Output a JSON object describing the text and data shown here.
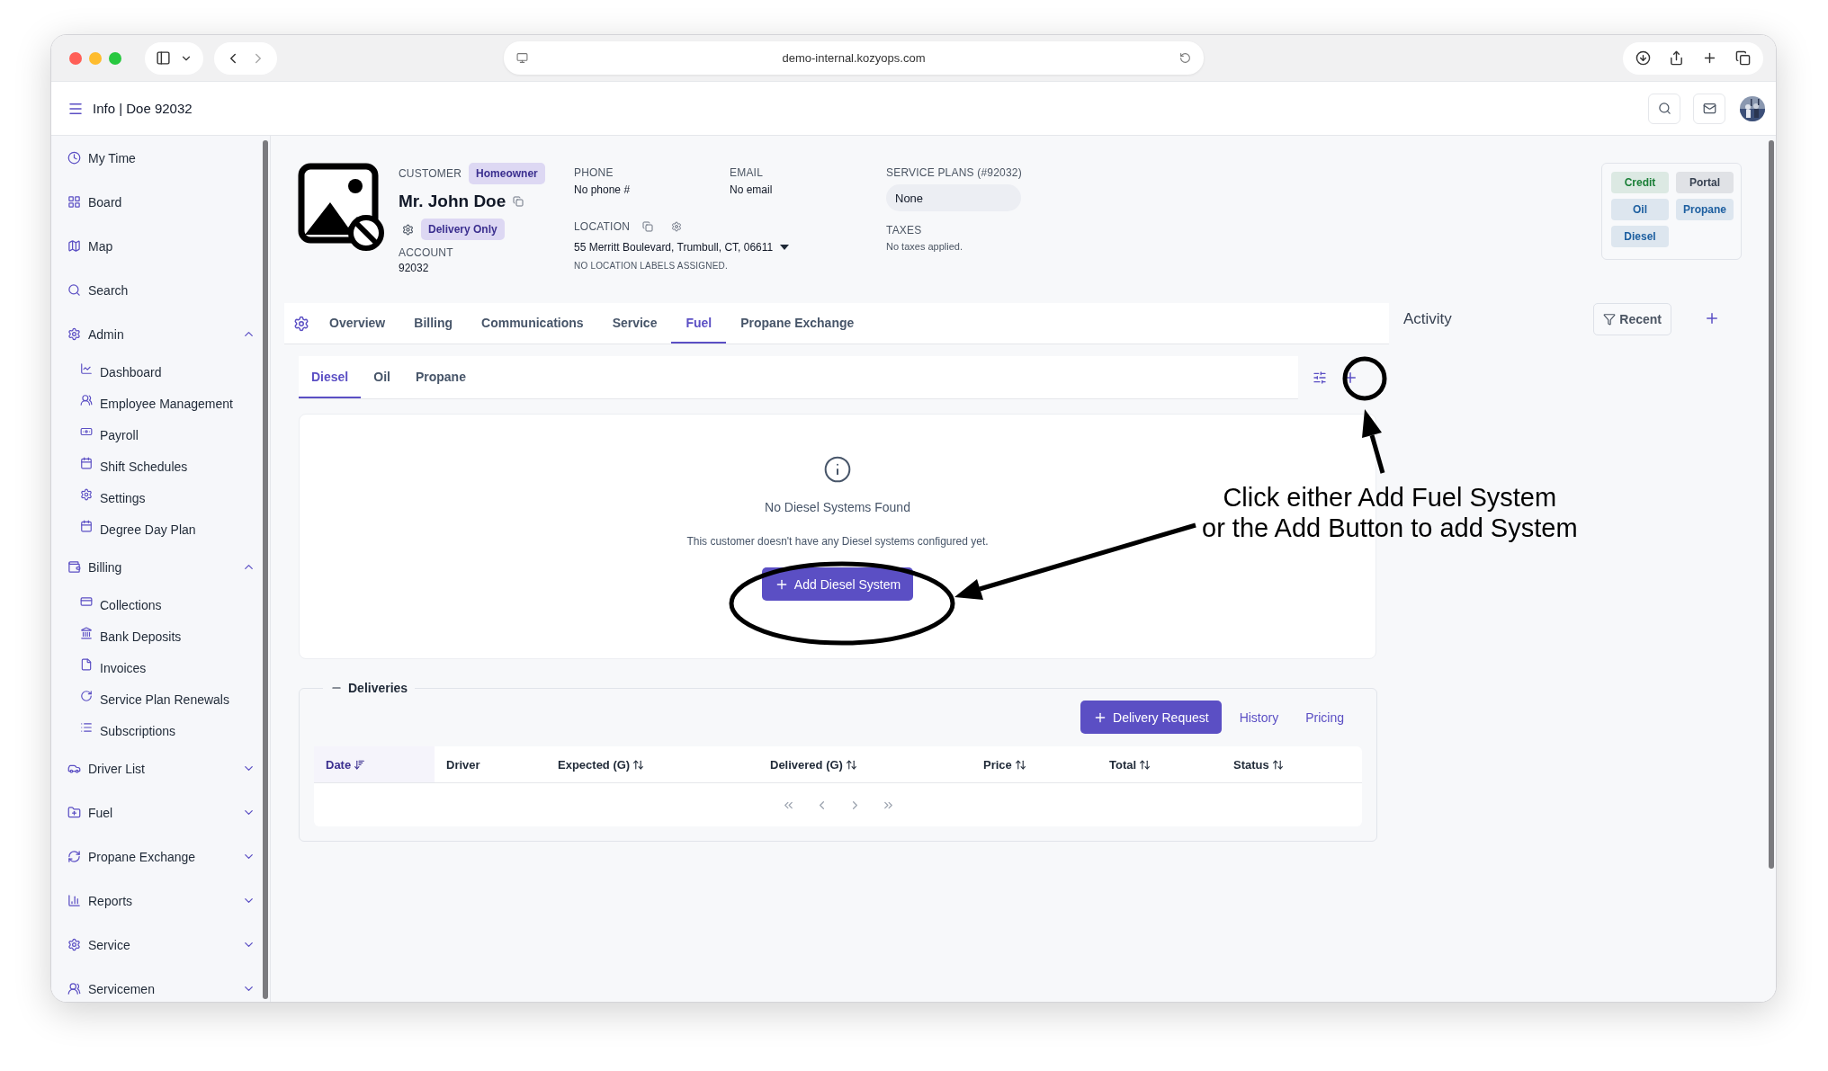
{
  "browser": {
    "url": "demo-internal.kozyops.com"
  },
  "header": {
    "title": "Info | Doe 92032"
  },
  "sidebar": {
    "items": [
      {
        "label": "My Time"
      },
      {
        "label": "Board"
      },
      {
        "label": "Map"
      },
      {
        "label": "Search"
      },
      {
        "label": "Admin",
        "expanded": true,
        "children": [
          {
            "label": "Dashboard"
          },
          {
            "label": "Employee Management"
          },
          {
            "label": "Payroll"
          },
          {
            "label": "Shift Schedules"
          },
          {
            "label": "Settings"
          },
          {
            "label": "Degree Day Plan"
          }
        ]
      },
      {
        "label": "Billing",
        "expanded": true,
        "children": [
          {
            "label": "Collections"
          },
          {
            "label": "Bank Deposits"
          },
          {
            "label": "Invoices"
          },
          {
            "label": "Service Plan Renewals"
          },
          {
            "label": "Subscriptions"
          }
        ]
      },
      {
        "label": "Driver List",
        "expanded": false
      },
      {
        "label": "Fuel",
        "expanded": false
      },
      {
        "label": "Propane Exchange",
        "expanded": false
      },
      {
        "label": "Reports",
        "expanded": false
      },
      {
        "label": "Service",
        "expanded": false
      },
      {
        "label": "Servicemen",
        "expanded": false
      }
    ]
  },
  "customer": {
    "label": "CUSTOMER",
    "type_badge": "Homeowner",
    "name": "Mr. John Doe",
    "delivery_badge": "Delivery Only",
    "account_label": "ACCOUNT",
    "account": "92032"
  },
  "contact": {
    "phone_label": "PHONE",
    "phone": "No phone #",
    "email_label": "EMAIL",
    "email": "No email",
    "location_label": "LOCATION",
    "location": "55 Merritt Boulevard, Trumbull, CT, 06611",
    "location_note": "NO LOCATION LABELS ASSIGNED."
  },
  "plans": {
    "label": "SERVICE PLANS (#92032)",
    "value": "None",
    "taxes_label": "TAXES",
    "taxes": "No taxes applied."
  },
  "tags": [
    {
      "label": "Credit",
      "color": "#1a7f37"
    },
    {
      "label": "Portal",
      "color": "#374151"
    },
    {
      "label": "Oil",
      "color": "#1d5fa0"
    },
    {
      "label": "Propane",
      "color": "#1d5fa0"
    },
    {
      "label": "Diesel",
      "color": "#1d5fa0"
    }
  ],
  "tabs": [
    {
      "label": "Overview",
      "selected": false
    },
    {
      "label": "Billing",
      "selected": false
    },
    {
      "label": "Communications",
      "selected": false
    },
    {
      "label": "Service",
      "selected": false
    },
    {
      "label": "Fuel",
      "selected": true
    },
    {
      "label": "Propane Exchange",
      "selected": false
    }
  ],
  "fuel_tabs": [
    {
      "label": "Diesel",
      "selected": true
    },
    {
      "label": "Oil",
      "selected": false
    },
    {
      "label": "Propane",
      "selected": false
    }
  ],
  "empty_state": {
    "title": "No Diesel Systems Found",
    "message": "This customer doesn't have any Diesel systems configured yet.",
    "button": "Add Diesel System"
  },
  "deliveries": {
    "title": "Deliveries",
    "actions": [
      {
        "label": "Delivery Request",
        "kind": "primary"
      },
      {
        "label": "History",
        "kind": "link"
      },
      {
        "label": "Pricing",
        "kind": "link"
      }
    ],
    "columns": [
      {
        "label": "Date",
        "sorted": true
      },
      {
        "label": "Driver"
      },
      {
        "label": "Expected (G)",
        "sorted": false
      },
      {
        "label": "Delivered (G)",
        "sorted": false
      },
      {
        "label": "Price",
        "sorted": false
      },
      {
        "label": "Total",
        "sorted": false
      },
      {
        "label": "Status",
        "sorted": false
      }
    ]
  },
  "activity": {
    "title": "Activity",
    "filter": "Recent"
  },
  "annotation": {
    "lines": [
      "Click either Add Fuel System",
      "or the Add Button to add System"
    ]
  }
}
